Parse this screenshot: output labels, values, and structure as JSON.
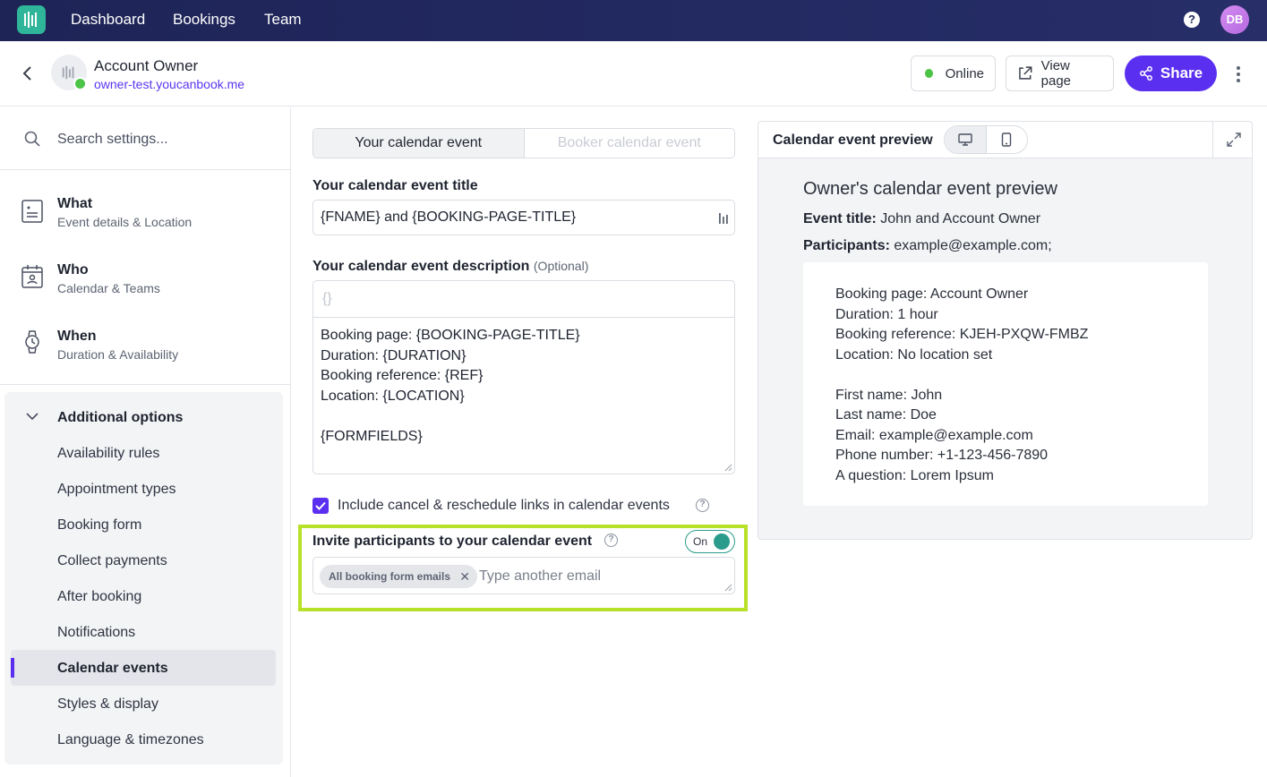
{
  "nav": {
    "links": [
      "Dashboard",
      "Bookings",
      "Team"
    ],
    "help": "?",
    "avatar_initials": "DB"
  },
  "header": {
    "owner_name": "Account Owner",
    "owner_url": "owner-test.youcanbook.me",
    "status": "Online",
    "view_page": "View page",
    "share": "Share"
  },
  "sidebar": {
    "search_placeholder": "Search settings...",
    "sections": [
      {
        "title": "What",
        "subtitle": "Event details & Location"
      },
      {
        "title": "Who",
        "subtitle": "Calendar & Teams"
      },
      {
        "title": "When",
        "subtitle": "Duration & Availability"
      }
    ],
    "additional": {
      "title": "Additional options",
      "items": [
        "Availability rules",
        "Appointment types",
        "Booking form",
        "Collect payments",
        "After booking",
        "Notifications",
        "Calendar events",
        "Styles & display",
        "Language & timezones"
      ],
      "active_item": "Calendar events"
    }
  },
  "editor": {
    "tabs": [
      "Your calendar event",
      "Booker calendar event"
    ],
    "title_label": "Your calendar event title",
    "title_value": "{FNAME} and {BOOKING-PAGE-TITLE}",
    "desc_label": "Your calendar event description",
    "desc_optional": "(Optional)",
    "desc_toolbar": "{}",
    "desc_value": "Booking page: {BOOKING-PAGE-TITLE}\nDuration: {DURATION}\nBooking reference: {REF}\nLocation: {LOCATION}\n\n{FORMFIELDS}",
    "include_links_label": "Include cancel & reschedule links in calendar events",
    "invite_label": "Invite participants to your calendar event",
    "toggle_label": "On",
    "chip_label": "All booking form emails",
    "email_placeholder": "Type another email"
  },
  "preview": {
    "title": "Calendar event preview",
    "heading": "Owner's calendar event preview",
    "event_title_label": "Event title:",
    "event_title_value": "John and Account Owner",
    "participants_label": "Participants:",
    "participants_value": "example@example.com;",
    "body": "Booking page: Account Owner\nDuration: 1 hour\nBooking reference: KJEH-PXQW-FMBZ\nLocation: No location set\n\nFirst name: John\nLast name: Doe\nEmail: example@example.com\nPhone number: +1-123-456-7890\nA question: Lorem Ipsum"
  },
  "colors": {
    "nav_bg": "#1e2456",
    "accent": "#5b2ff0",
    "online": "#4cc447",
    "highlight": "#b8e22a",
    "toggle": "#2b9c8b"
  }
}
